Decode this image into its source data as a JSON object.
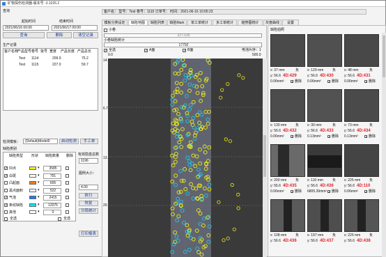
{
  "window": {
    "title": "矿物探伤检测器-版本号 -3.1025.2"
  },
  "left": {
    "start_label": "起始时间",
    "end_label": "结束时间",
    "start_value": "2021/06/16 00:00",
    "end_value": "2021/06/17 00:00",
    "query": "查询",
    "delete": "删除",
    "clear_log": "清空记录",
    "table_headers": [
      "客户名称",
      "产品型号",
      "卷号",
      "批号",
      "宽度",
      "产品长度",
      "产品总长"
    ],
    "rows": [
      [
        "",
        "Test",
        "1114",
        "",
        "209.9",
        "",
        "75.2"
      ],
      [
        "",
        "Test",
        "1115",
        "",
        "227.0",
        "",
        "59.7"
      ]
    ],
    "log_label": "生产记录",
    "template_label": "检测模板：",
    "template_value": "(Default)Model0",
    "start_detect": "启动检测",
    "manual_change": "手工单",
    "defect_label": "缺陷类别",
    "defect_headers": [
      "缺陷类型",
      "形状",
      "缺陷数量",
      "删除"
    ],
    "defects": [
      [
        "凹点",
        "3585"
      ],
      [
        "白斑",
        "791"
      ],
      [
        "凸起面",
        "605"
      ],
      [
        "黑点面积",
        "522"
      ],
      [
        "气泡",
        "2415"
      ],
      [
        "条纹缺陷",
        "12075"
      ],
      [
        "其他",
        "0"
      ]
    ],
    "select_all": "全选",
    "delete_all": "全选",
    "effective_label": "有效隐患总数",
    "effective_value": "1196",
    "scale_label": "图例大小：",
    "scale_value": "4.00",
    "execute": "执行",
    "recover": "恢复",
    "export": "分段统计",
    "print_report": "打印报表"
  },
  "info": {
    "text": "客户名：   型号：Test   卷号：1115   订单号：   时间：2021-06-16 10:05:23"
  },
  "tabs": [
    "模板分类设定",
    "缺陷地图",
    "缺陷列表",
    "缺陷Mark",
    "单工单统计",
    "多工单统计",
    "趋势图统计",
    "灰度曲线",
    "设置"
  ],
  "map": {
    "show_label": "小卷",
    "length_value": "227.035",
    "sub_label": "小卷缺陷统计",
    "sub_value": "17792",
    "select_all": "全选",
    "a_label": "A面",
    "b_label": "B面",
    "dir_label": "电池片序：1",
    "x_ticks": [
      "0.0",
      "500.0"
    ],
    "y_ticks": [
      "14.0",
      "6.75",
      "13.0",
      "20.0"
    ]
  },
  "thumbs": {
    "title": "缺陷拍照",
    "cards": [
      {
        "x": "x: 37 mm",
        "xn": "负",
        "y": "y: 56.6",
        "id": "4D:429",
        "area": "0.06mm²",
        "del": "删除"
      },
      {
        "x": "x: 129 mm",
        "xn": "负",
        "y": "y: 56.6",
        "id": "4D:430",
        "area": "0.06mm²",
        "del": "删除"
      },
      {
        "x": "x: 48 mm",
        "xn": "负",
        "y": "y: 56.6",
        "id": "4D:431",
        "area": "0.06mm²",
        "del": "删除"
      },
      {
        "x": "x: 130 mm",
        "xn": "负",
        "y": "y: 56.6",
        "id": "4D:432",
        "area": "0.06mm²",
        "del": "删除"
      },
      {
        "x": "x: 30 mm",
        "xn": "负",
        "y": "y: 56.6",
        "id": "4D:433",
        "area": "0.13mm²",
        "del": "删除"
      },
      {
        "x": "x: 73 mm",
        "xn": "负",
        "y": "y: 56.6",
        "id": "4D:434",
        "area": "0.13mm²",
        "del": "删除"
      },
      {
        "x": "x: 200 mm",
        "xn": "负",
        "y": "y: 56.6",
        "id": "4D:435",
        "area": "0.06mm²",
        "del": "删除"
      },
      {
        "x": "x: 110 mm",
        "xn": "负",
        "y": "y: 56.6",
        "id": "4D:436",
        "area": "6805.39mm²",
        "del": "删除"
      },
      {
        "x": "x: 225 mm",
        "xn": "负",
        "y": "y: 56.6",
        "id": "4D:110",
        "area": "0.06mm²",
        "del": "删除"
      },
      {
        "x": "x: 108 mm",
        "xn": "负",
        "y": "y: 56.6",
        "id": "4D:436",
        "area": "",
        "del": ""
      },
      {
        "x": "x: 197 mm",
        "xn": "负",
        "y": "y: 56.6",
        "id": "4D:437",
        "area": "",
        "del": ""
      },
      {
        "x": "x: 225 mm",
        "xn": "负",
        "y": "y: 56.6",
        "id": "4D:438",
        "area": "",
        "del": ""
      }
    ]
  }
}
